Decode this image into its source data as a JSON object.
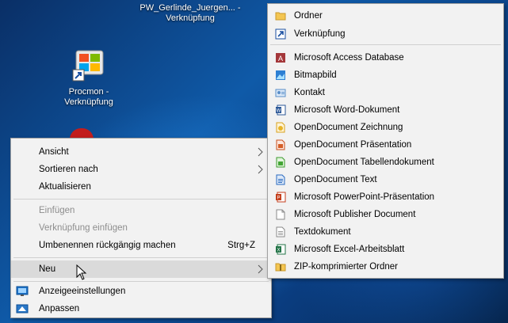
{
  "desktop": {
    "pw_icon_label": "PW_Gerlinde_Juergen... - Verknüpfung",
    "procmon_label_1": "Procmon -",
    "procmon_label_2": "Verknüpfung"
  },
  "context_menu": {
    "items": [
      {
        "label": "Ansicht",
        "has_submenu": true
      },
      {
        "label": "Sortieren nach",
        "has_submenu": true
      },
      {
        "label": "Aktualisieren"
      },
      {
        "label": "Einfügen",
        "disabled": true
      },
      {
        "label": "Verknüpfung einfügen",
        "disabled": true
      },
      {
        "label": "Umbenennen rückgängig machen",
        "shortcut": "Strg+Z"
      },
      {
        "label": "Neu",
        "has_submenu": true,
        "highlighted": true
      },
      {
        "label": "Anzeigeeinstellungen",
        "icon": "display-icon"
      },
      {
        "label": "Anpassen",
        "icon": "personalize-icon"
      }
    ]
  },
  "new_submenu": {
    "items": [
      {
        "label": "Ordner",
        "icon": "folder-icon"
      },
      {
        "label": "Verknüpfung",
        "icon": "shortcut-icon"
      },
      {
        "label": "Microsoft Access Database",
        "icon": "access-icon"
      },
      {
        "label": "Bitmapbild",
        "icon": "bitmap-icon"
      },
      {
        "label": "Kontakt",
        "icon": "contact-icon"
      },
      {
        "label": "Microsoft Word-Dokument",
        "icon": "word-icon"
      },
      {
        "label": "OpenDocument Zeichnung",
        "icon": "odg-icon"
      },
      {
        "label": "OpenDocument Präsentation",
        "icon": "odp-icon"
      },
      {
        "label": "OpenDocument Tabellendokument",
        "icon": "ods-icon"
      },
      {
        "label": "OpenDocument Text",
        "icon": "odt-icon"
      },
      {
        "label": "Microsoft PowerPoint-Präsentation",
        "icon": "powerpoint-icon"
      },
      {
        "label": "Microsoft Publisher Document",
        "icon": "publisher-icon"
      },
      {
        "label": "Textdokument",
        "icon": "text-icon"
      },
      {
        "label": "Microsoft Excel-Arbeitsblatt",
        "icon": "excel-icon"
      },
      {
        "label": "ZIP-komprimierter Ordner",
        "icon": "zip-icon"
      }
    ]
  },
  "colors": {
    "menu_bg": "#f2f2f2",
    "highlight": "#dadada",
    "disabled_text": "#8d8d8d"
  }
}
